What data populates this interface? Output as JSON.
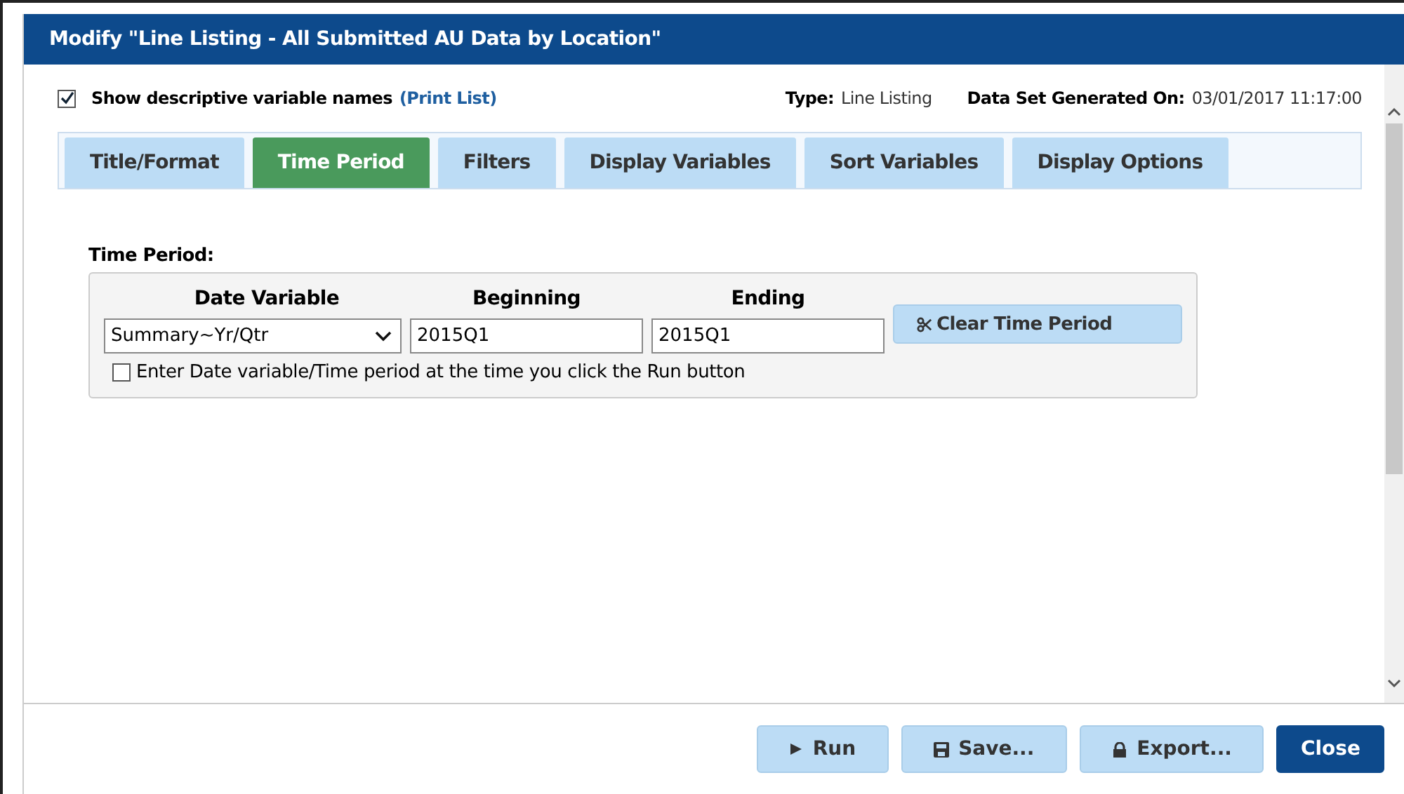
{
  "window": {
    "title": "Modify \"Line Listing - All Submitted AU Data by Location\""
  },
  "header": {
    "show_names": {
      "label": "Show descriptive variable names",
      "checked": true,
      "link": "(Print List)"
    },
    "type_label": "Type:",
    "type_value": "Line Listing",
    "generated_label": "Data Set Generated On:",
    "generated_value": "03/01/2017 11:17:00"
  },
  "tabs": [
    {
      "label": "Title/Format",
      "selected": false
    },
    {
      "label": "Time Period",
      "selected": true
    },
    {
      "label": "Filters",
      "selected": false
    },
    {
      "label": "Display Variables",
      "selected": false
    },
    {
      "label": "Sort Variables",
      "selected": false
    },
    {
      "label": "Display Options",
      "selected": false
    }
  ],
  "time_period": {
    "heading": "Time Period:",
    "columns": [
      "Date Variable",
      "Beginning",
      "Ending"
    ],
    "date_variable": "Summary~Yr/Qtr",
    "beginning": "2015Q1",
    "ending": "2015Q1",
    "clear_button": "Clear Time Period",
    "prompt": {
      "label": "Enter Date variable/Time period at the time you click the Run button",
      "checked": false
    }
  },
  "buttons": [
    {
      "label": "Run",
      "kind": "run"
    },
    {
      "label": "Save...",
      "kind": "save"
    },
    {
      "label": "Export...",
      "kind": "export"
    },
    {
      "label": "Close",
      "kind": "close"
    }
  ]
}
